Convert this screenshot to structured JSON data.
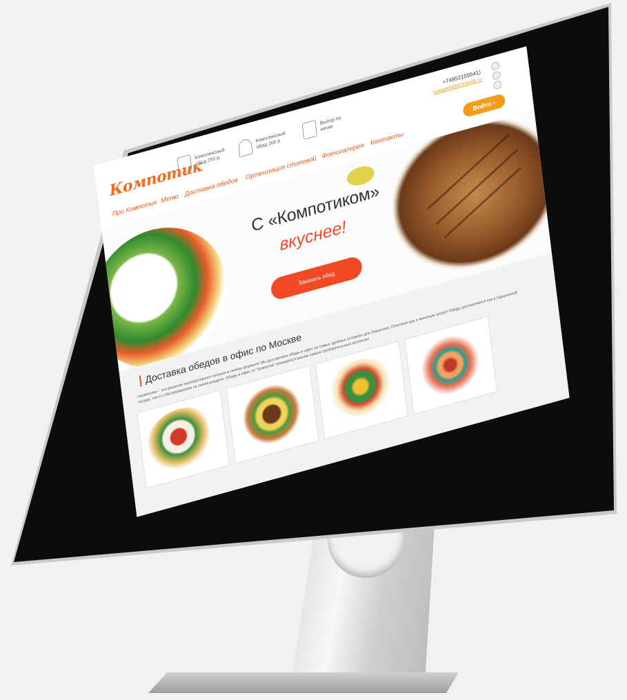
{
  "header": {
    "logo": "Компотик",
    "features": [
      {
        "icon": "lunch-box-icon",
        "text": "Комплексный обед 250 р"
      },
      {
        "icon": "cloche-icon",
        "text": "Комплексный обед 200 р"
      },
      {
        "icon": "menu-card-icon",
        "text": "Выбор по меню"
      }
    ],
    "phone": "+74952155541)",
    "email": "kompotik@kompotik.ru",
    "login_label": "Войти"
  },
  "nav": {
    "items": [
      "Про Компотик",
      "Меню",
      "Доставка обедов",
      "Организация столовой",
      "Фотогалерея",
      "Контакты"
    ]
  },
  "hero": {
    "title_line1": "С «Компотиком»",
    "title_line2": "вкуснее!",
    "order_label": "Заказать обед"
  },
  "section": {
    "title": "Доставка обедов в офис по Москве",
    "description": "«Компотик» - это решение корпоративного питания в любом формате! Мы доставляем обеды в офис на самых удобных условиях для Заказчика. Отличная еда и минимум затрат! Обеды доставляются как в порционной посуде, так и с обслуживанием на линии раздачи. Обеды в офис от \"Компотик\" понравятся вашим самым требовательным коллегам!"
  },
  "colors": {
    "accent": "#ef4a24",
    "login": "#f39c1a",
    "logo": "#f26a1b"
  }
}
